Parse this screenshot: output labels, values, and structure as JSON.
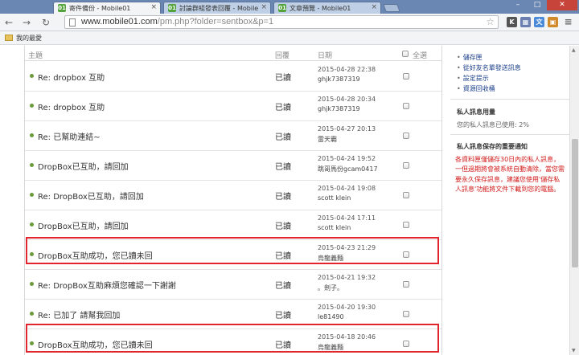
{
  "browser": {
    "tabs": [
      {
        "title": "寄件備份 - Mobile01",
        "active": true
      },
      {
        "title": "討論群組發表回覆 - Mobile",
        "active": false
      },
      {
        "title": "文章預覽 - Mobile01",
        "active": false
      }
    ],
    "url_host": "www.mobile01.com",
    "url_path": "/pm.php?folder=sentbox&p=1",
    "bookmark": "我的最愛",
    "favicon_glyph": "01",
    "ext_icons": [
      {
        "name": "k-icon",
        "glyph": "K",
        "color": "#555555"
      },
      {
        "name": "grid-icon",
        "glyph": "▦",
        "color": "#6a7fb0"
      },
      {
        "name": "translate-icon",
        "glyph": "文",
        "color": "#4a8ad8"
      },
      {
        "name": "puzzle-icon",
        "glyph": "▣",
        "color": "#d08a2a"
      },
      {
        "name": "menu-icon",
        "glyph": "≡",
        "color": "#777777"
      }
    ]
  },
  "table": {
    "headers": {
      "subject": "主題",
      "reply": "回覆",
      "date": "日期",
      "select_all": "全選"
    },
    "rows": [
      {
        "subject": "Re: dropbox 互助",
        "status": "已讀",
        "date": "2015-04-28 22:38",
        "sender": "ghjk7387319"
      },
      {
        "subject": "Re: dropbox 互助",
        "status": "已讀",
        "date": "2015-04-28 20:34",
        "sender": "ghjk7387319"
      },
      {
        "subject": "Re: 已幫助連結~",
        "status": "已讀",
        "date": "2015-04-27 20:13",
        "sender": "雷天霸"
      },
      {
        "subject": "DropBox已互助，請回加",
        "status": "已讀",
        "date": "2015-04-24 19:52",
        "sender": "跳哥馬份gcam0417"
      },
      {
        "subject": "Re: DropBox已互助，請回加",
        "status": "已讀",
        "date": "2015-04-24 19:08",
        "sender": "scott klein"
      },
      {
        "subject": "DropBox已互助，請回加",
        "status": "已讀",
        "date": "2015-04-24 17:11",
        "sender": "scott klein"
      },
      {
        "subject": "DropBox互助成功，您已讀未回",
        "status": "已讀",
        "date": "2015-04-23 21:29",
        "sender": "烏龍義麵"
      },
      {
        "subject": "Re: DropBox互助麻煩您確認一下謝謝",
        "status": "已讀",
        "date": "2015-04-21 19:32",
        "sender": "。劍子。"
      },
      {
        "subject": "Re: 已加了 請幫我回加",
        "status": "已讀",
        "date": "2015-04-20 19:30",
        "sender": "le81490"
      },
      {
        "subject": "DropBox互助成功，您已讀未回",
        "status": "已讀",
        "date": "2015-04-18 20:46",
        "sender": "烏龍義麵"
      }
    ]
  },
  "sidebar": {
    "links": [
      "儲存匣",
      "從好友名單發送訊息",
      "設定提示",
      "資源回收桶"
    ],
    "usage_heading": "私人訊息用量",
    "usage_text": "您的私人訊息已使用: 2%",
    "notice_heading": "私人訊息保存的重要通知",
    "notice_text": "各資料匣僅儲存30日內的私人訊息，一但過期將會被系統自動清除，當您需要永久保存訊息，建議您使用'儲存私人訊息'功能將文件下載到您的電腦。"
  },
  "colors": {
    "highlight": "#e0252d",
    "link": "#1a3f8a",
    "notice": "#d11a1a"
  }
}
